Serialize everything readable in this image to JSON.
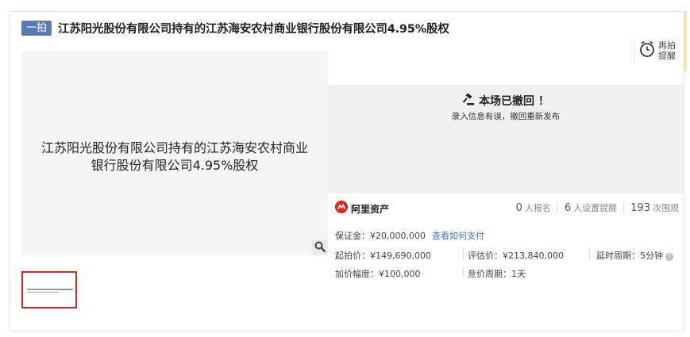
{
  "listing": {
    "badge": "一拍",
    "title": "江苏阳光股份有限公司持有的江苏海安农村商业银行股份有限公司4.95%股权"
  },
  "image": {
    "line1": "江苏阳光股份有限公司持有的江苏海安农村商业",
    "line2": "银行股份有限公司4.95%股权"
  },
  "remind": {
    "label_line1": "再拍",
    "label_line2": "提醒"
  },
  "status": {
    "title": "本场已撤回 ！",
    "subtitle": "录入信息有误，撤回重新发布"
  },
  "platform": {
    "name": "阿里资产"
  },
  "stats": {
    "signups": "0",
    "signups_label": "人报名",
    "reminders": "6",
    "reminders_label": "人设置提醒",
    "views": "193",
    "views_label": "次围观"
  },
  "details": {
    "deposit": "保证金：¥20,000,000",
    "how_to_pay": "查看如何支付",
    "start_price": "起拍价：¥149,690,000",
    "appraisal": "评估价：¥213,840,000",
    "delay": "延时周期：5分钟",
    "increment": "加价幅度：¥100,000",
    "bid_cycle": "竞价周期：1天"
  },
  "colors": {
    "accent_red": "#d7261e",
    "badge_blue": "#5b7ab2",
    "link_blue": "#3b73c9"
  }
}
